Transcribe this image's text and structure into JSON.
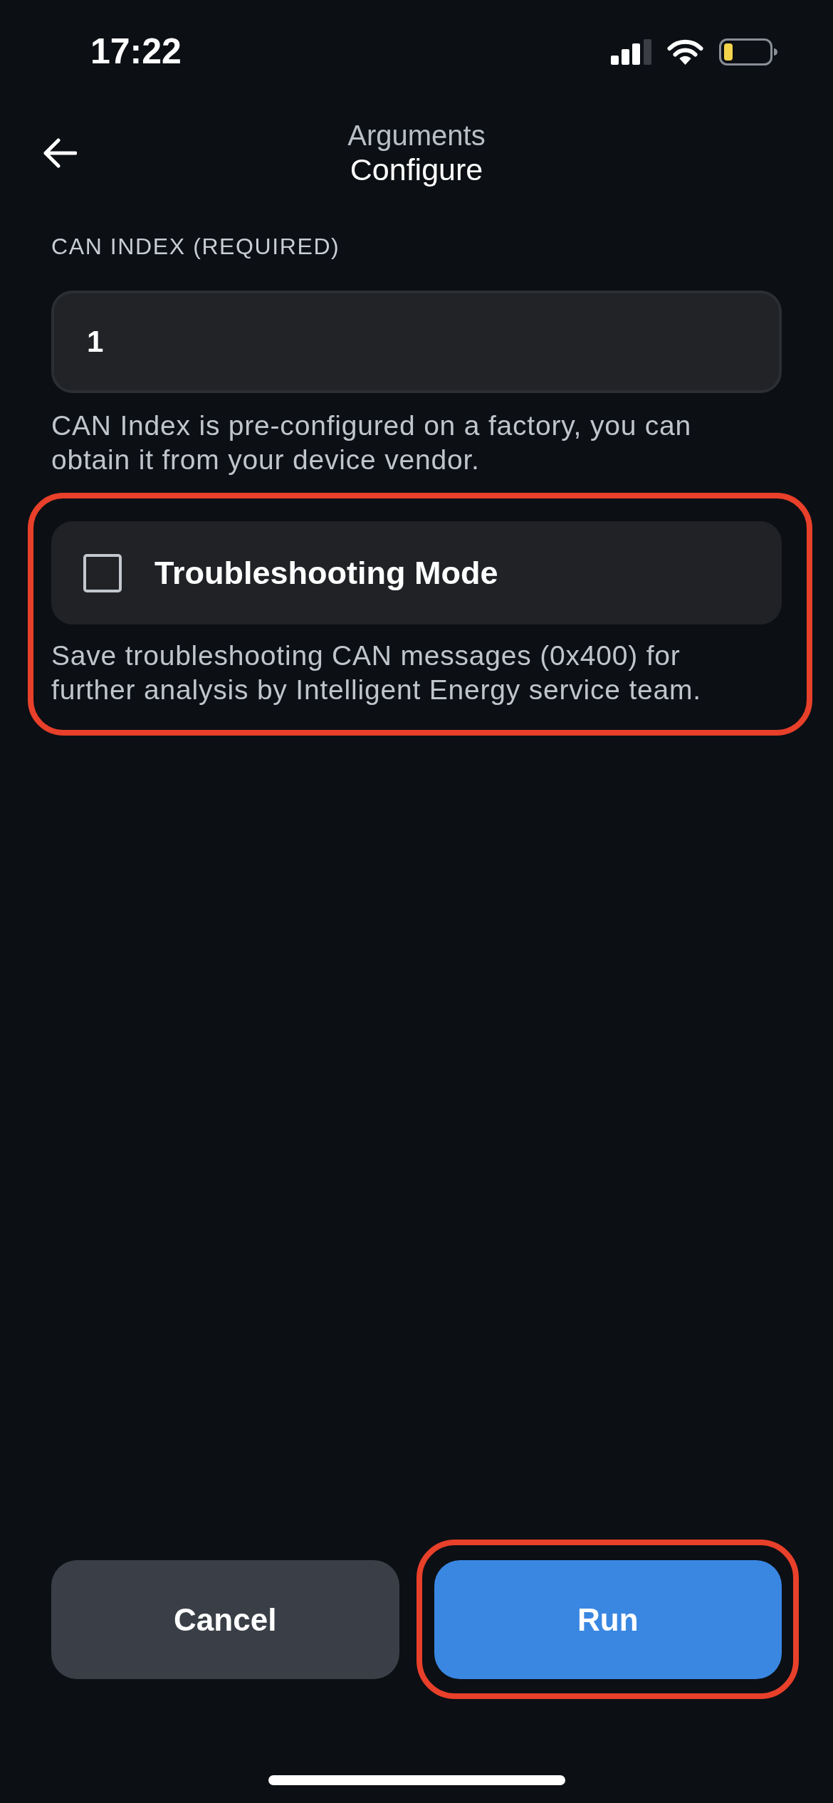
{
  "status_bar": {
    "time": "17:22"
  },
  "header": {
    "subtitle": "Arguments",
    "title": "Configure"
  },
  "fields": [
    {
      "kind": "text",
      "label": "CAN INDEX (REQUIRED)",
      "value": "1",
      "help": "CAN Index is pre-configured on a factory, you can obtain it from your device vendor.",
      "highlighted": false
    },
    {
      "kind": "checkbox",
      "label": "Troubleshooting Mode",
      "checked": false,
      "help": "Save troubleshooting CAN messages (0x400) for further analysis by Intelligent Energy service team.",
      "highlighted": true
    }
  ],
  "buttons": [
    {
      "label": "Cancel",
      "kind": "secondary",
      "highlighted": false
    },
    {
      "label": "Run",
      "kind": "primary",
      "highlighted": true
    }
  ]
}
